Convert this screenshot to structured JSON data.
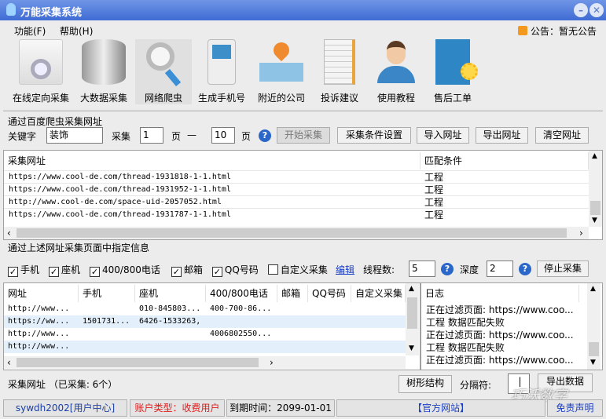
{
  "window": {
    "title": "万能采集系统"
  },
  "menu": [
    {
      "label": "功能(F)"
    },
    {
      "label": "帮助(H)"
    }
  ],
  "notice": "公告：暂无公告",
  "toolbar": [
    {
      "label": "在线定向采集",
      "icon": "document-search-icon"
    },
    {
      "label": "大数据采集",
      "icon": "database-icon"
    },
    {
      "label": "网络爬虫",
      "icon": "magnifier-icon"
    },
    {
      "label": "生成手机号",
      "icon": "mobile-phone-icon"
    },
    {
      "label": "附近的公司",
      "icon": "map-pin-icon"
    },
    {
      "label": "投诉建议",
      "icon": "notebook-icon"
    },
    {
      "label": "使用教程",
      "icon": "user-help-icon"
    },
    {
      "label": "售后工单",
      "icon": "ticket-gear-icon"
    }
  ],
  "crawl": {
    "section_title": "通过百度爬虫采集网址",
    "keyword_label": "关键字",
    "keyword": "装饰",
    "collect_label": "采集",
    "page_from": "1",
    "page_label": "页",
    "dash": "—",
    "page_to": "10",
    "page_label2": "页",
    "start": "开始采集",
    "conditions": "采集条件设置",
    "import": "导入网址",
    "export": "导出网址",
    "clear": "清空网址"
  },
  "url_table": {
    "headers": [
      "采集网址",
      "匹配条件"
    ],
    "rows": [
      [
        "https://www.cool-de.com/thread-1931818-1-1.html",
        "工程"
      ],
      [
        "https://www.cool-de.com/thread-1931952-1-1.html",
        "工程"
      ],
      [
        "http://www.cool-de.com/space-uid-2057052.html",
        "工程"
      ],
      [
        "https://www.cool-de.com/thread-1931787-1-1.html",
        "工程"
      ]
    ]
  },
  "extract": {
    "section_title": "通过上述网址采集页面中指定信息",
    "options": [
      {
        "label": "手机",
        "checked": true
      },
      {
        "label": "座机",
        "checked": true
      },
      {
        "label": "400/800电话",
        "checked": true
      },
      {
        "label": "邮箱",
        "checked": true
      },
      {
        "label": "QQ号码",
        "checked": true
      },
      {
        "label": "自定义采集",
        "checked": false
      }
    ],
    "edit": "编辑",
    "threads_label": "线程数:",
    "threads": "5",
    "depth_label": "深度",
    "depth": "2",
    "stop": "停止采集"
  },
  "result_table": {
    "headers": [
      "网址",
      "手机",
      "座机",
      "400/800电话",
      "邮箱",
      "QQ号码",
      "自定义采集"
    ],
    "rows": [
      [
        "http://www...",
        "",
        "010-845803...",
        "400-700-86...",
        "",
        "",
        ""
      ],
      [
        "https://ww...",
        "1501731...",
        "6426-1533263,",
        "",
        "",
        "",
        ""
      ],
      [
        "http://www...",
        "",
        "",
        "4006802550...",
        "",
        "",
        ""
      ],
      [
        "http://www...",
        "",
        "",
        "",
        "",
        "",
        ""
      ]
    ]
  },
  "log": {
    "header": "日志",
    "lines": [
      "正在过滤页面: https://www.coo...",
      "工程 数据匹配失败",
      "正在过滤页面: https://www.coo...",
      "工程 数据匹配失败",
      "正在过滤页面: https://www.coo..."
    ]
  },
  "status": {
    "text": "采集网址 （已采集: 6个）",
    "tree": "树形结构",
    "sep_label": "分隔符:",
    "sep": "|",
    "export": "导出数据"
  },
  "footer": {
    "user": "sywdh2002[用户中心]",
    "account": "账户类型：收费用户",
    "expire": "到期时间：2099-01-01",
    "site": "【官方网站】",
    "disclaimer": "免责声明"
  },
  "watermark": "巧沃数字"
}
